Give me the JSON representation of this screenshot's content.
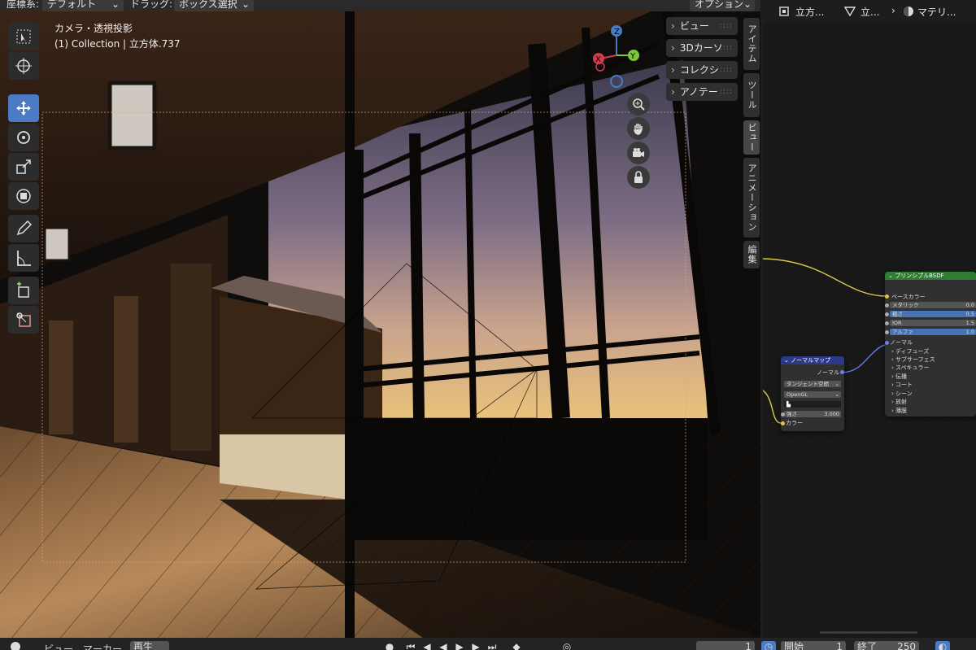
{
  "header": {
    "orientation_label": "座標系:",
    "orientation_value": "デフォルト",
    "drag_label": "ドラッグ:",
    "drag_value": "ボックス選択",
    "options_label": "オプション"
  },
  "viewport": {
    "view_name": "カメラ・透視投影",
    "collection_info": "(1) Collection | 立方体.737",
    "gizmo": {
      "x": "X",
      "y": "Y",
      "z": "Z"
    }
  },
  "sidebar_popovers": [
    "ビュー",
    "3Dカーソ",
    "コレクシ",
    "アノテー"
  ],
  "sidebar_tabs": [
    "アイテム",
    "ツール",
    "ビュー",
    "アニメーション",
    "編集"
  ],
  "tools": [
    "select-box",
    "cursor",
    "move",
    "rotate",
    "scale",
    "transform",
    "annotate",
    "measure",
    "add-cube",
    "scale-cage"
  ],
  "node_editor": {
    "breadcrumb": [
      "立方...",
      "立...",
      "マテリ..."
    ],
    "principled_node": {
      "title": "プリンシプルBSDF",
      "rows": [
        {
          "label": "ベースカラー"
        },
        {
          "label": "メタリック",
          "value": "0.0"
        },
        {
          "label": "粗さ",
          "value": "0.5"
        },
        {
          "label": "IOR",
          "value": "1.5"
        },
        {
          "label": "アルファ",
          "value": "1.0"
        },
        {
          "label": "ノーマル"
        },
        {
          "label": "ディフューズ"
        },
        {
          "label": "サブサーフェス"
        },
        {
          "label": "スペキュラー"
        },
        {
          "label": "伝播"
        },
        {
          "label": "コート"
        },
        {
          "label": "シーン"
        },
        {
          "label": "放射"
        },
        {
          "label": "薄膜"
        }
      ]
    },
    "normal_map_node": {
      "title": "ノーマルマップ",
      "output": "ノーマル",
      "space": "タンジェント空間",
      "uvmap": "OpenGL",
      "strength_label": "強さ",
      "strength_value": "3.000",
      "color_input": "カラー"
    }
  },
  "timeline": {
    "view_label": "ビュー",
    "marker_label": "マーカー",
    "playback_label": "再生",
    "current_frame": "1",
    "start_label": "開始",
    "start_value": "1",
    "end_label": "終了",
    "end_value": "250"
  },
  "colors": {
    "accent_blue": "#4a7bc4",
    "principled_header": "#2e7d32",
    "normal_map_header": "#2c3a8a",
    "link_yellow": "#d8c84a",
    "link_blue": "#5a7ee6"
  }
}
